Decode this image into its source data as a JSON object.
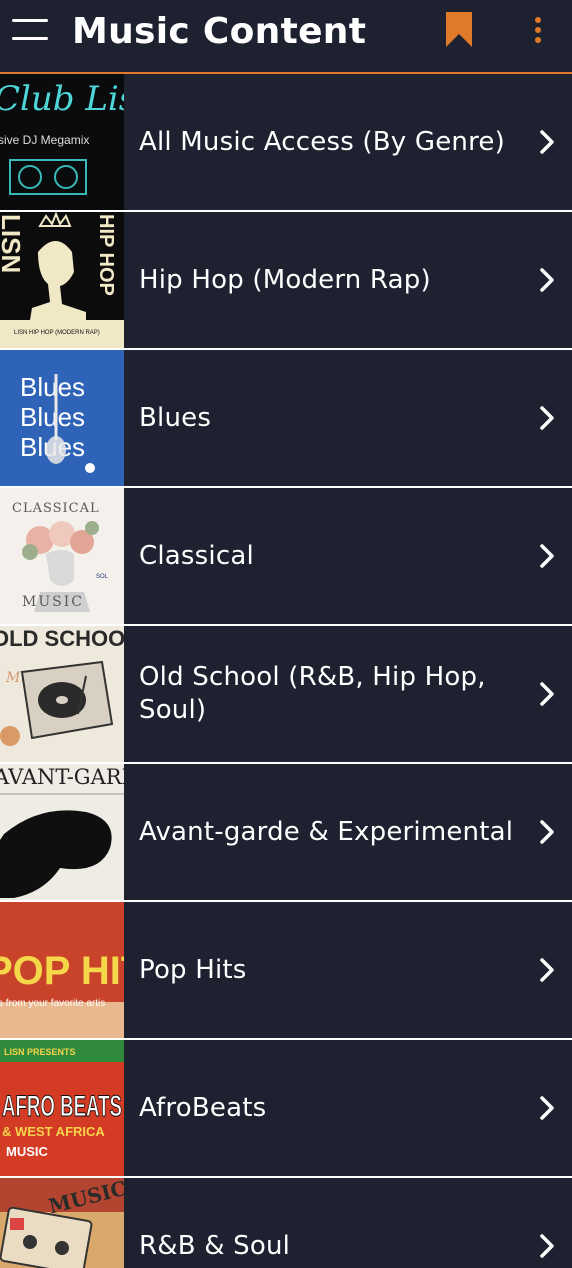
{
  "header": {
    "title": "Music Content",
    "menu_icon": "hamburger-menu-icon",
    "bookmark_icon": "bookmark-icon",
    "more_icon": "more-vertical-icon",
    "accent_color": "#e07a2a"
  },
  "items": [
    {
      "label": "All Music Access (By Genre)",
      "thumb_text": "Club Lisn",
      "thumb_sub": "sive DJ Megamix"
    },
    {
      "label": "Hip Hop (Modern Rap)",
      "thumb_text": "LISN",
      "thumb_side": "HIP HOP",
      "thumb_sub": "LISN HIP HOP (MODERN RAP)"
    },
    {
      "label": "Blues",
      "thumb_text": "Blues"
    },
    {
      "label": "Classical",
      "thumb_text": "CLASSICAL",
      "thumb_sub": "MUSIC",
      "thumb_badge": "SOL"
    },
    {
      "label": "Old School (R&B, Hip Hop, Soul)",
      "thumb_text": "OLD SCHOOL",
      "thumb_sub": "Music"
    },
    {
      "label": "Avant-garde & Experimental",
      "thumb_text": "AVANT-GARDE"
    },
    {
      "label": "Pop Hits",
      "thumb_text": "POP HITS",
      "thumb_sub": "s from your favorite artis"
    },
    {
      "label": "AfroBeats",
      "thumb_text": "AFRO BEATS",
      "thumb_sub": "& WEST AFRICA",
      "thumb_tag": "LISN PRESENTS",
      "thumb_sub2": "MUSIC"
    },
    {
      "label": "R&B & Soul",
      "thumb_text": "MUSIC"
    }
  ]
}
